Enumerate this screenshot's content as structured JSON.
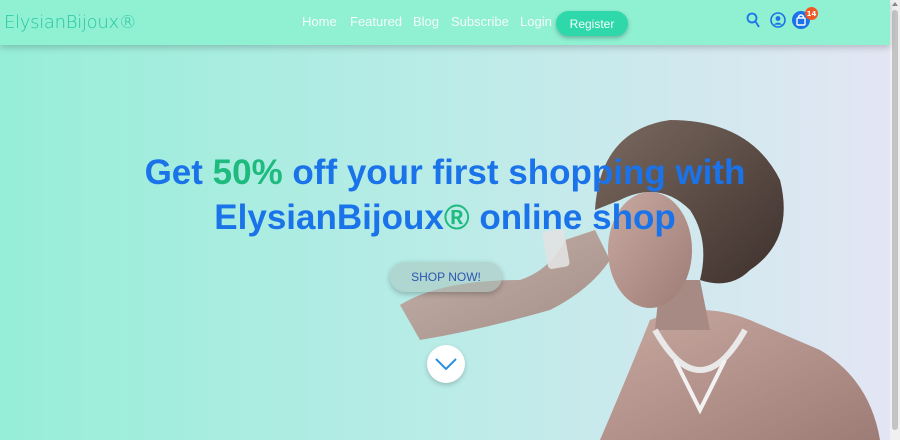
{
  "brand": {
    "name": "ElysianBijoux®"
  },
  "nav": {
    "links": [
      "Home",
      "Featured",
      "Blog",
      "Subscribe",
      "Login"
    ],
    "register_label": "Register"
  },
  "header_icons": {
    "search": "search-icon",
    "account": "user-icon",
    "cart": "shopping-bag-icon",
    "cart_count": "14"
  },
  "hero": {
    "line1_pre": "Get ",
    "line1_accent": "50%",
    "line1_post": " off your first shopping with",
    "line2_pre": "ElysianBijoux",
    "line2_accent": "®",
    "line2_post": " online shop",
    "cta_label": "SHOP NOW!",
    "scroll_icon": "chevron-down-icon"
  },
  "colors": {
    "navbar": "#8ff0d2",
    "headline": "#1a73e8",
    "accent": "#1fba7e",
    "badge": "#f15a24"
  }
}
